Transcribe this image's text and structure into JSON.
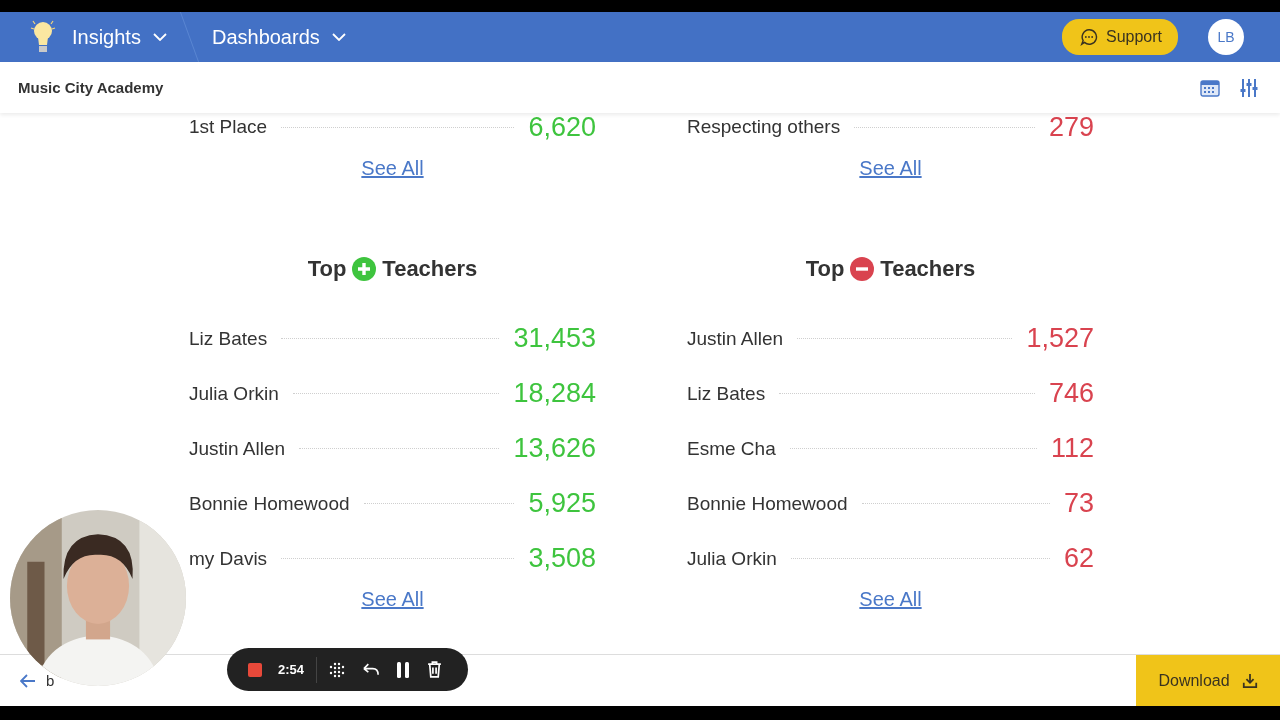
{
  "header": {
    "app": "Insights",
    "dashboards": "Dashboards",
    "support": "Support",
    "avatar": "LB"
  },
  "subheader": {
    "title": "Music City Academy"
  },
  "previous_sections": [
    {
      "kind": "positive",
      "rows": [
        {
          "name": "1st Place",
          "value": "6,620"
        }
      ],
      "link": "See All"
    },
    {
      "kind": "negative",
      "rows": [
        {
          "name": "Respecting others",
          "value": "279"
        }
      ],
      "link": "See All"
    }
  ],
  "sections": [
    {
      "kind": "positive",
      "title_before": "Top",
      "title_after": "Teachers",
      "rows": [
        {
          "name": "Liz Bates",
          "value": "31,453"
        },
        {
          "name": "Julia Orkin",
          "value": "18,284"
        },
        {
          "name": "Justin Allen",
          "value": "13,626"
        },
        {
          "name": "Bonnie Homewood",
          "value": "5,925"
        },
        {
          "name": "my Davis",
          "value": "3,508"
        }
      ],
      "link": "See All"
    },
    {
      "kind": "negative",
      "title_before": "Top",
      "title_after": "Teachers",
      "rows": [
        {
          "name": "Justin Allen",
          "value": "1,527"
        },
        {
          "name": "Liz Bates",
          "value": "746"
        },
        {
          "name": "Esme Cha",
          "value": "112"
        },
        {
          "name": "Bonnie Homewood",
          "value": "73"
        },
        {
          "name": "Julia Orkin",
          "value": "62"
        }
      ],
      "link": "See All"
    }
  ],
  "footer": {
    "back": "b",
    "download": "Download"
  },
  "recorder": {
    "time": "2:54"
  }
}
